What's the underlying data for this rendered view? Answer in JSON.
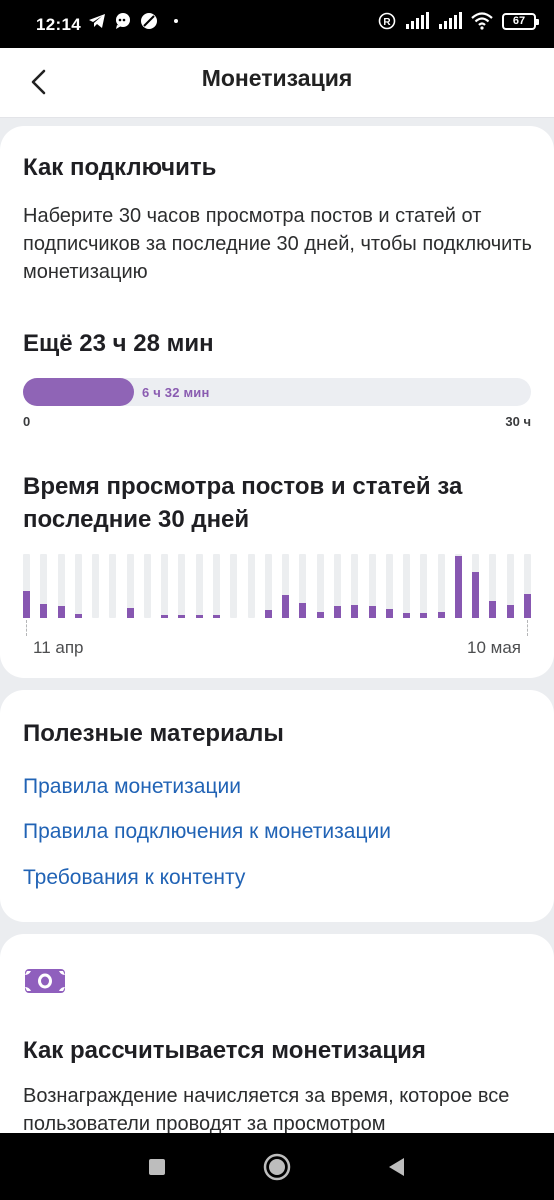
{
  "status_bar": {
    "time": "12:14",
    "battery": "67",
    "icons": [
      "telegram-icon",
      "chat-bubble-icon",
      "no-access-icon",
      "dot-icon",
      "registered-icon",
      "signal-icon",
      "signal-icon",
      "wifi-icon",
      "battery-icon"
    ]
  },
  "header": {
    "title": "Монетизация",
    "back_icon": "back-arrow-icon"
  },
  "connect_card": {
    "title": "Как подключить",
    "description": "Наберите 30 часов просмотра постов и статей от подписчиков за последние 30 дней, чтобы подключить монетизацию",
    "remaining": "Ещё 23 ч 28 мин",
    "progress": {
      "value_label": "6 ч 32 мин",
      "fraction": 0.2178,
      "min_label": "0",
      "max_label": "30 ч",
      "accent_color": "#8f64b6"
    },
    "chart_title": "Время просмотра постов и статей за последние 30 дней",
    "chart_data": {
      "type": "bar",
      "title": "Время просмотра постов и статей за последние 30 дней",
      "x_start_label": "11 апр",
      "x_end_label": "10 мая",
      "values": [
        0.42,
        0.22,
        0.19,
        0.07,
        0.0,
        0.0,
        0.15,
        0.0,
        0.04,
        0.04,
        0.04,
        0.04,
        0.0,
        0.0,
        0.12,
        0.36,
        0.24,
        0.1,
        0.18,
        0.2,
        0.18,
        0.14,
        0.08,
        0.08,
        0.1,
        0.97,
        0.72,
        0.26,
        0.2,
        0.38
      ],
      "ylim": [
        0,
        1
      ],
      "bar_color": "#8757b1",
      "track_color": "#eceef0"
    }
  },
  "materials_card": {
    "title": "Полезные материалы",
    "links": [
      "Правила монетизации",
      "Правила подключения к монетизации",
      "Требования к контенту"
    ],
    "link_color": "#2163b5"
  },
  "calc_card": {
    "icon": "money-banknote-icon",
    "title": "Как рассчитывается монетизация",
    "description": "Вознаграждение начисляется за время, которое все пользователи проводят за просмотром"
  },
  "nav_bar": {
    "buttons": [
      "recents-square-icon",
      "home-circle-icon",
      "back-triangle-icon"
    ]
  }
}
